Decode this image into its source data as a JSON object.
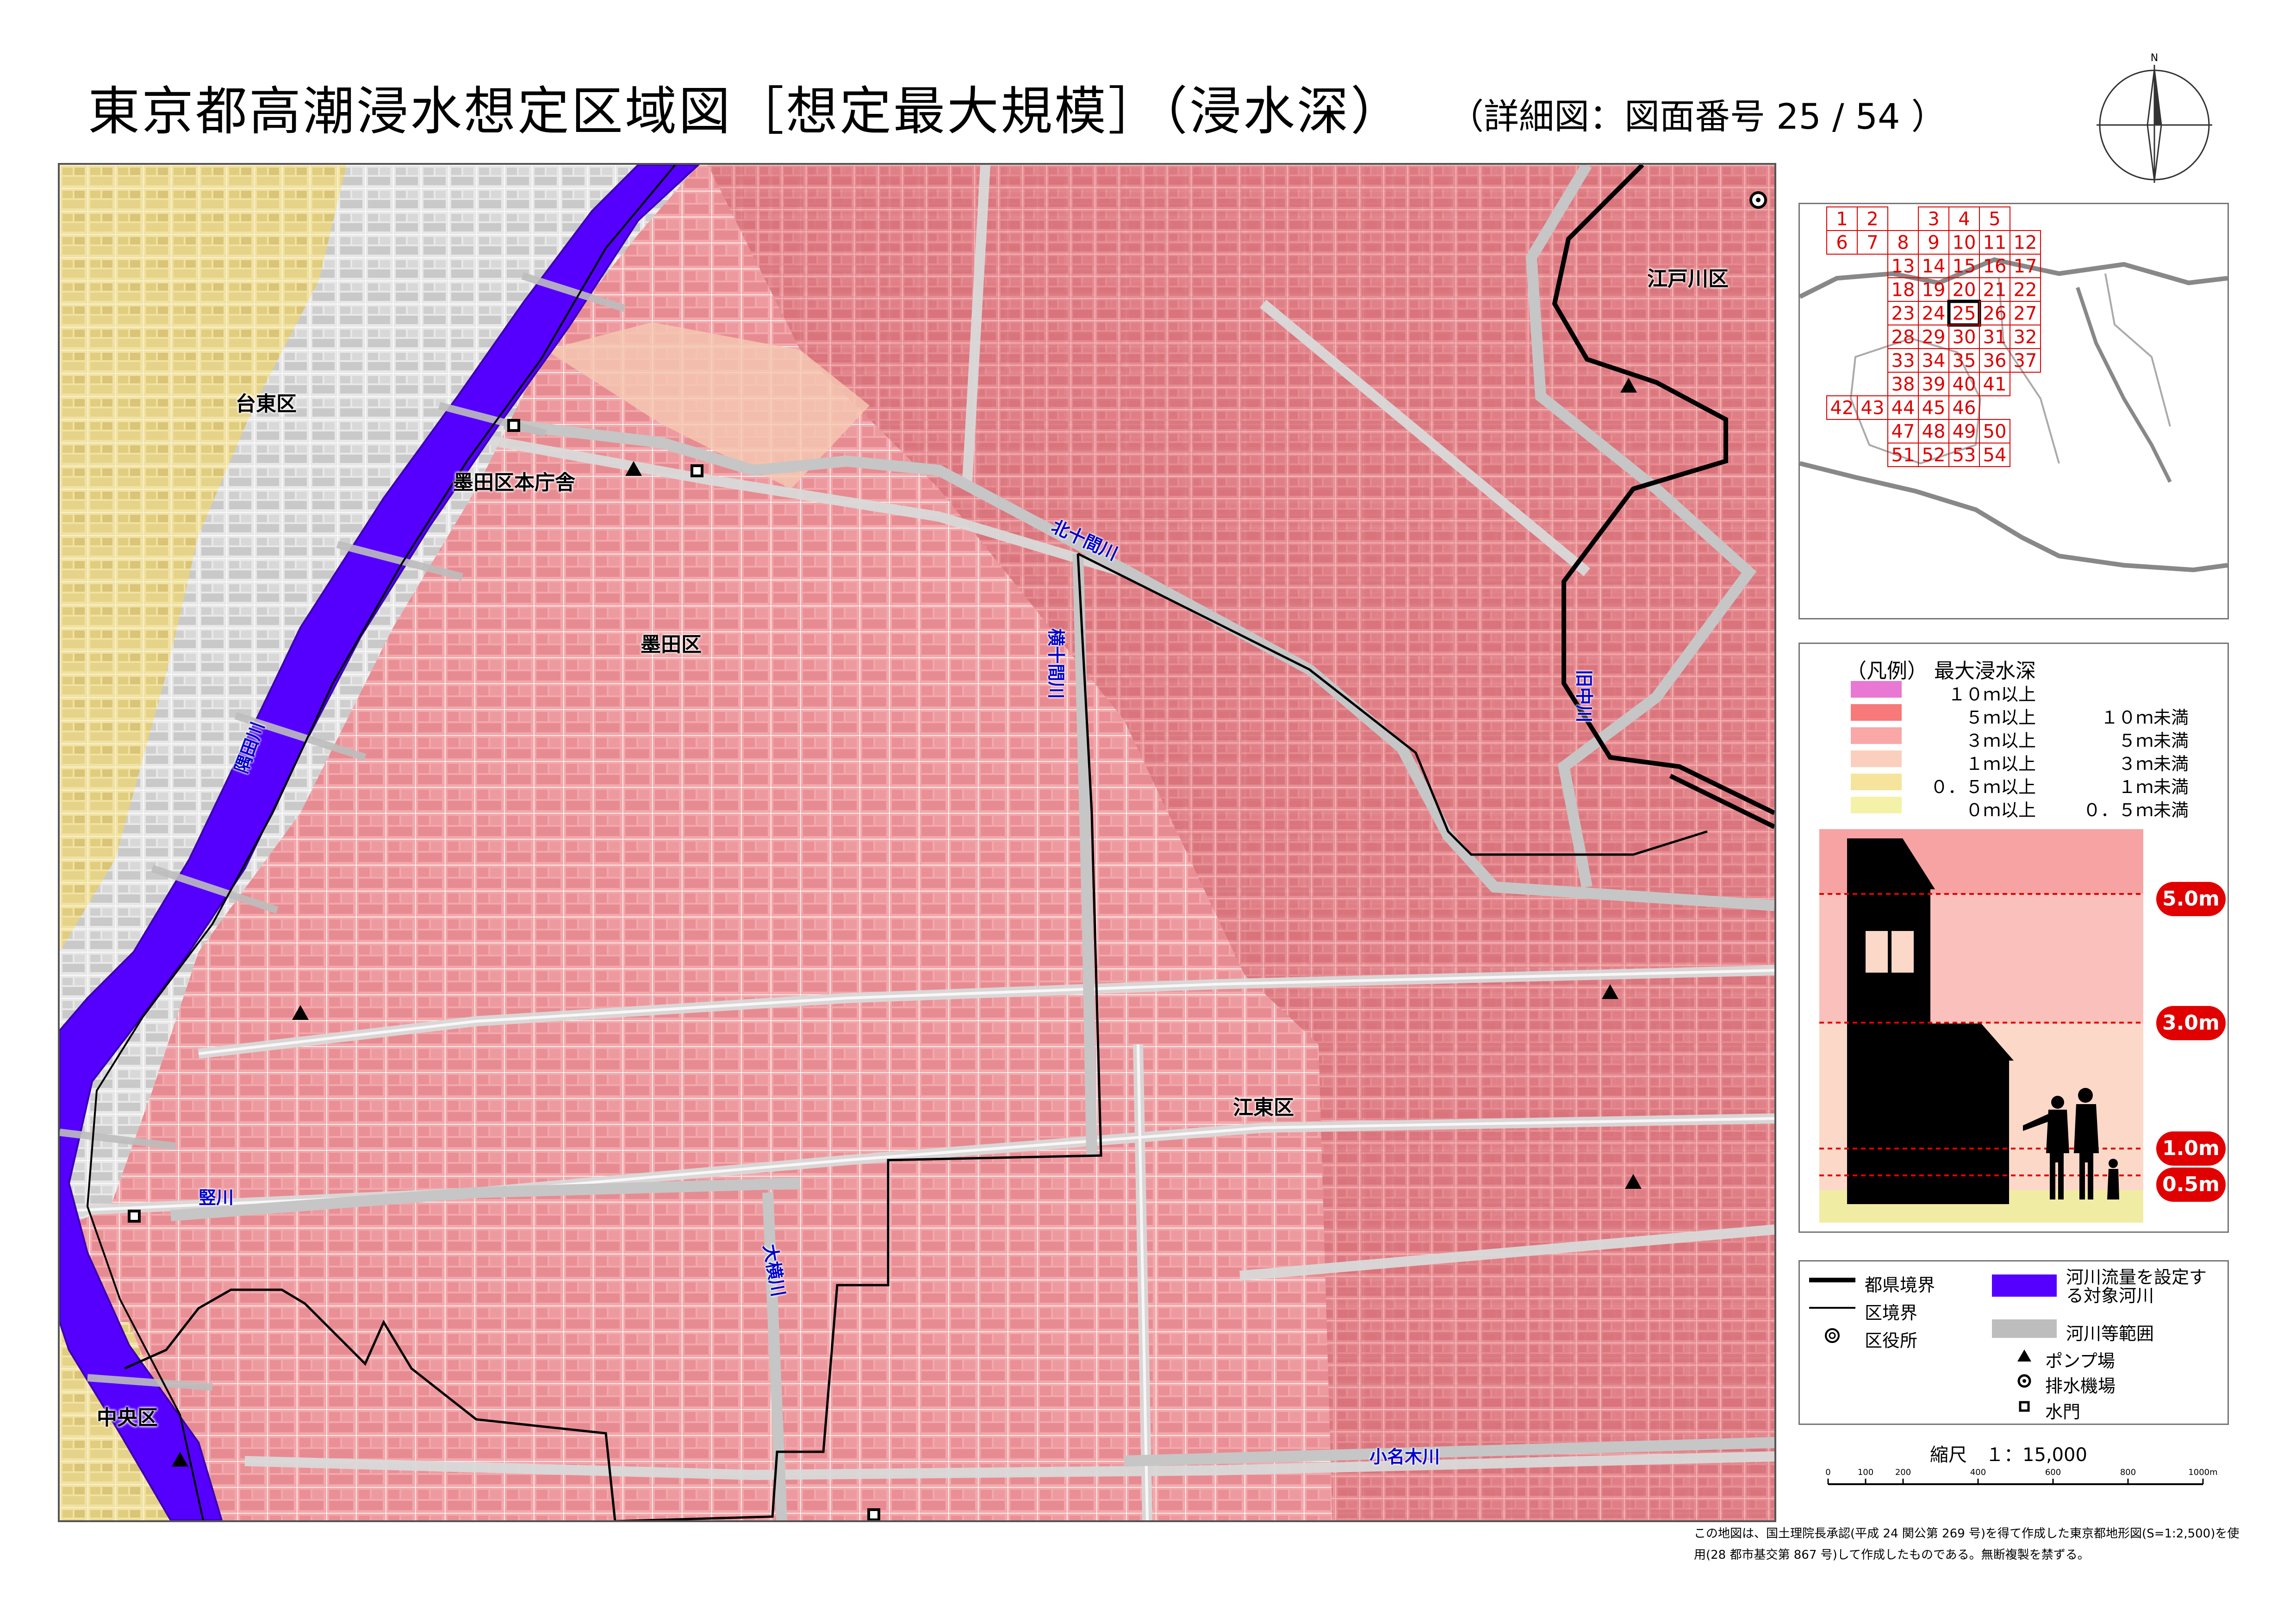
{
  "title": "東京都高潮浸水想定区域図［想定最大規模］（浸水深）",
  "subtitle": "（詳細図：図面番号 25 / 54 ）",
  "compass": {
    "label": "N"
  },
  "map": {
    "labels": {
      "taito": "台東区",
      "sumida_office": "墨田区本庁舎",
      "sumida": "墨田区",
      "edogawa": "江戸川区",
      "koto": "江東区",
      "chuo": "中央区"
    },
    "rivers": {
      "sumidagawa": "隅田川",
      "kitajukkengawa": "北十間川",
      "yokojukkengawa": "横十間川",
      "kyunakagawa": "旧中川",
      "tatekawa": "竪川",
      "oyokogawa": "大横川",
      "onagigawa": "小名木川"
    }
  },
  "index_map": {
    "current": "25",
    "rows": [
      [
        "1",
        "2",
        "",
        "3",
        "4",
        "5"
      ],
      [
        "6",
        "7",
        "8",
        "9",
        "10",
        "11",
        "12"
      ],
      [
        "13",
        "14",
        "15",
        "16",
        "17"
      ],
      [
        "18",
        "19",
        "20",
        "21",
        "22"
      ],
      [
        "23",
        "24",
        "25",
        "26",
        "27"
      ],
      [
        "28",
        "29",
        "30",
        "31",
        "32"
      ],
      [
        "33",
        "34",
        "35",
        "36",
        "37"
      ],
      [
        "38",
        "39",
        "40",
        "41"
      ],
      [
        "42",
        "43",
        "44",
        "45",
        "46"
      ],
      [
        "47",
        "48",
        "49",
        "50"
      ],
      [
        "51",
        "52",
        "53",
        "54"
      ]
    ]
  },
  "legend": {
    "title": "（凡例） 最大浸水深",
    "items": [
      {
        "color": "#e978d4",
        "from": "１０ｍ以上",
        "to": ""
      },
      {
        "color": "#f7797a",
        "from": "５ｍ以上",
        "to": "１０ｍ未満"
      },
      {
        "color": "#f9a7a7",
        "from": "３ｍ以上",
        "to": "５ｍ未満"
      },
      {
        "color": "#fbcfbd",
        "from": "１ｍ以上",
        "to": "３ｍ未満"
      },
      {
        "color": "#f6e49d",
        "from": "０．５ｍ以上",
        "to": "１ｍ未満"
      },
      {
        "color": "#f4f2a8",
        "from": "０ｍ以上",
        "to": "０．５ｍ未満"
      }
    ],
    "depth_labels": [
      "5.0m",
      "3.0m",
      "1.0m",
      "0.5m"
    ]
  },
  "symbols": {
    "pref_border": "都県境界",
    "ward_border": "区境界",
    "ward_office": "区役所",
    "target_river": "河川流量を設定する対象河川",
    "river_area": "河川等範囲",
    "pump": "ポンプ場",
    "drain": "排水機場",
    "gate": "水門",
    "colors": {
      "target_river": "#5500ff",
      "river_area": "#bdbdbd"
    }
  },
  "scale": {
    "label": "縮尺　１：15,000",
    "ticks": [
      "0",
      "100",
      "200",
      "400",
      "600",
      "800",
      "1000m"
    ]
  },
  "footnote": "この地図は、国土理院長承認(平成 24 関公第 269 号)を得て作成した東京都地形図(S=1:2,500)を使用(28 都市基交第 867 号)して作成したものである。無断複製を禁ずる。"
}
